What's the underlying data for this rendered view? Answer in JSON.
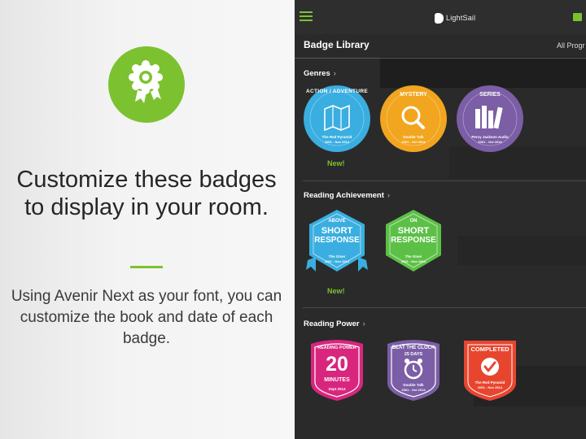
{
  "promo": {
    "headline": "Customize these badges to display in your room.",
    "body": "Using Avenir Next as your font, you can customize the book and date of each badge."
  },
  "app": {
    "logo": "LightSail",
    "page_title": "Badge Library",
    "filter": "All Progr",
    "sections": [
      {
        "label": "Genres",
        "badges": [
          {
            "name": "ACTION / ADVENTURE",
            "book": "The Red Pyramid",
            "date": "2001 - Nov 2014",
            "color": "#3aaee0"
          },
          {
            "name": "MYSTERY",
            "book": "Double Talk",
            "date": "2001 - Oct 2014",
            "color": "#f2a51f"
          },
          {
            "name": "SERIES",
            "book": "Percy Jackson Audio",
            "date": "2001 - Oct 2014",
            "color": "#7b5ea6"
          }
        ],
        "new_label": "New!"
      },
      {
        "label": "Reading Achievement",
        "badges": [
          {
            "line1": "ABOVE",
            "line2": "SHORT",
            "line3": "RESPONSE",
            "book": "The Giver",
            "date": "2001 - Nov 2014",
            "color": "#3aaee0"
          },
          {
            "line1": "ON",
            "line2": "SHORT",
            "line3": "RESPONSE",
            "book": "The Giver",
            "date": "2001 - Nov 2014",
            "color": "#5cc046"
          }
        ],
        "new_label": "New!"
      },
      {
        "label": "Reading Power",
        "badges": [
          {
            "title": "READING POWER",
            "value": "20",
            "unit": "MINUTES",
            "date": "Sept 2014",
            "color": "#d8267e"
          },
          {
            "title": "BEAT THE CLOCK",
            "value": "25 DAYS",
            "book": "Double Talk",
            "date": "2001 - Oct 2014",
            "color": "#7b5ea6"
          },
          {
            "title": "COMPLETED",
            "book": "The Red Pyramid",
            "date": "2001 - Nov 2014",
            "color": "#e8452f"
          }
        ]
      }
    ]
  },
  "colors": {
    "accent": "#7cc230",
    "app_bg": "#2a2a2a"
  },
  "icons": [
    "award-ribbon-icon",
    "menu-icon",
    "book-icon",
    "magnifier-icon",
    "check-icon",
    "clock-icon",
    "books-icon",
    "map-icon"
  ]
}
